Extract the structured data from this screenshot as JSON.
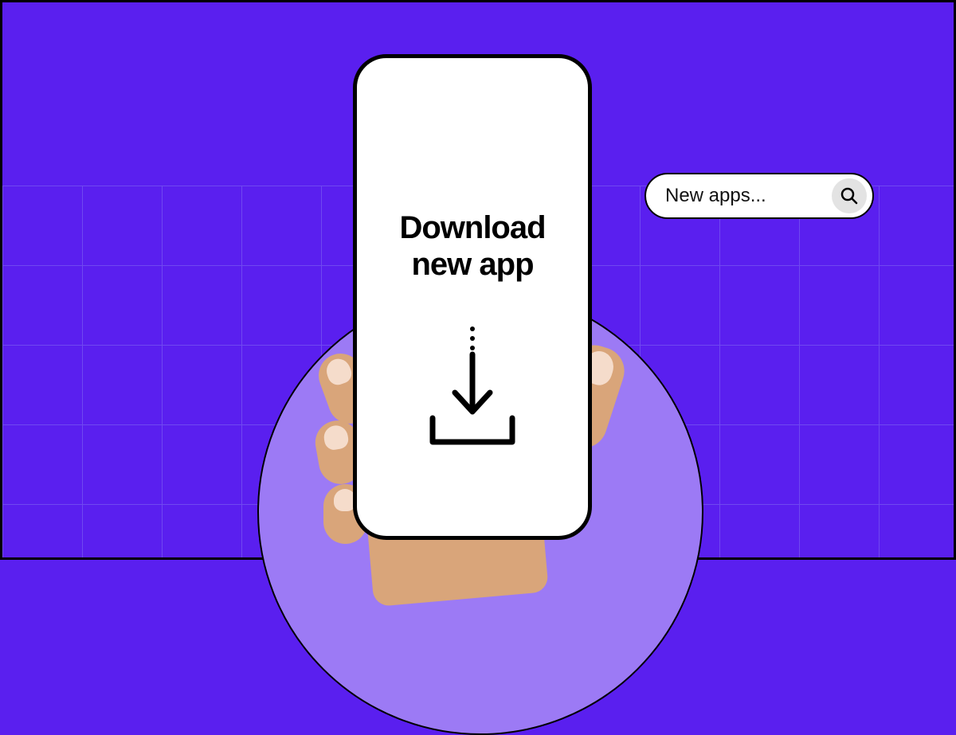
{
  "phone": {
    "headline_line1": "Download",
    "headline_line2": "new app"
  },
  "search": {
    "placeholder": "New apps..."
  },
  "colors": {
    "background": "#5a1fef",
    "circle": "#9c7af5",
    "phone_body": "#ffffff",
    "search_button": "#e3e3e3"
  }
}
